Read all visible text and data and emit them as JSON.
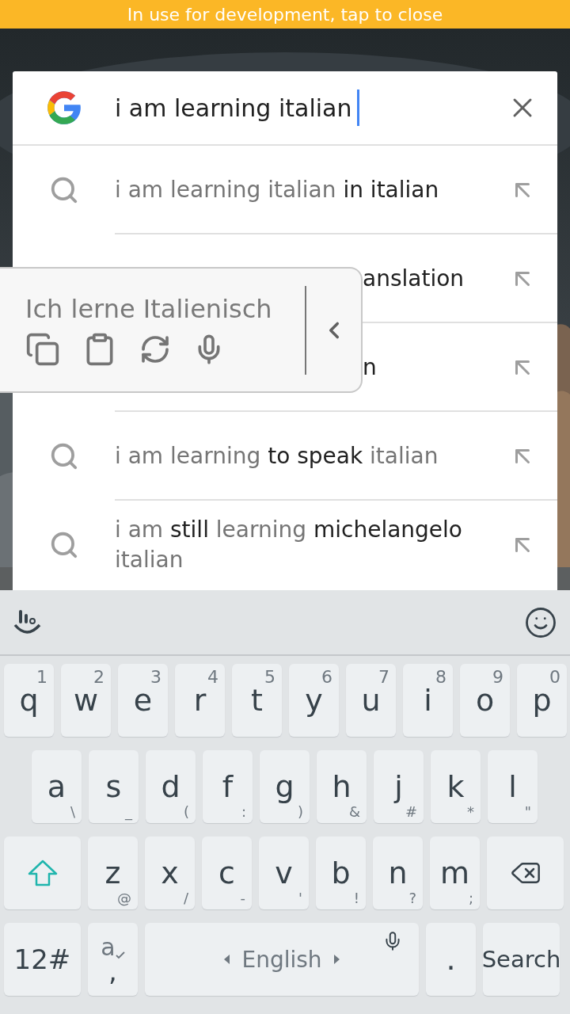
{
  "status_banner": {
    "text": "In use for development, tap to close"
  },
  "search": {
    "query": "i am learning italian",
    "focused": true
  },
  "suggestions": [
    {
      "covered": false,
      "segments": [
        {
          "text": "i am learning italian ",
          "typed": true
        },
        {
          "text": "in italian",
          "typed": false
        }
      ]
    },
    {
      "covered": true,
      "segments": [
        {
          "text": "anslation",
          "typed": false
        }
      ]
    },
    {
      "covered": true,
      "segments": [
        {
          "text": "n",
          "typed": false
        }
      ]
    },
    {
      "covered": false,
      "segments": [
        {
          "text": "i am learning ",
          "typed": true
        },
        {
          "text": "to speak",
          "typed": false
        },
        {
          "text": " italian",
          "typed": true
        }
      ]
    },
    {
      "covered": false,
      "segments": [
        {
          "text": "i am ",
          "typed": true
        },
        {
          "text": "still",
          "typed": false
        },
        {
          "text": " learning ",
          "typed": true
        },
        {
          "text": "michelangelo",
          "typed": false
        },
        {
          "text": " italian",
          "typed": true
        }
      ]
    }
  ],
  "translation_popup": {
    "text": "Ich lerne Italienisch"
  },
  "keyboard": {
    "rows": [
      {
        "keys": [
          {
            "kind": "letter",
            "char": "q",
            "number": "1"
          },
          {
            "kind": "letter",
            "char": "w",
            "number": "2"
          },
          {
            "kind": "letter",
            "char": "e",
            "number": "3"
          },
          {
            "kind": "letter",
            "char": "r",
            "number": "4"
          },
          {
            "kind": "letter",
            "char": "t",
            "number": "5"
          },
          {
            "kind": "letter",
            "char": "y",
            "number": "6"
          },
          {
            "kind": "letter",
            "char": "u",
            "number": "7"
          },
          {
            "kind": "letter",
            "char": "i",
            "number": "8"
          },
          {
            "kind": "letter",
            "char": "o",
            "number": "9"
          },
          {
            "kind": "letter",
            "char": "p",
            "number": "0"
          }
        ]
      },
      {
        "keys": [
          {
            "kind": "letter",
            "char": "a",
            "symbol": "\\"
          },
          {
            "kind": "letter",
            "char": "s",
            "symbol": "_"
          },
          {
            "kind": "letter",
            "char": "d",
            "symbol": "("
          },
          {
            "kind": "letter",
            "char": "f",
            "symbol": ":"
          },
          {
            "kind": "letter",
            "char": "g",
            "symbol": ")"
          },
          {
            "kind": "letter",
            "char": "h",
            "symbol": "&"
          },
          {
            "kind": "letter",
            "char": "j",
            "symbol": "#"
          },
          {
            "kind": "letter",
            "char": "k",
            "symbol": "*"
          },
          {
            "kind": "letter",
            "char": "l",
            "symbol": "\""
          }
        ]
      },
      {
        "keys": [
          {
            "kind": "shift"
          },
          {
            "kind": "letter",
            "char": "z",
            "symbol": "@"
          },
          {
            "kind": "letter",
            "char": "x",
            "symbol": "/"
          },
          {
            "kind": "letter",
            "char": "c",
            "symbol": "-"
          },
          {
            "kind": "letter",
            "char": "v",
            "symbol": "'"
          },
          {
            "kind": "letter",
            "char": "b",
            "symbol": "!"
          },
          {
            "kind": "letter",
            "char": "n",
            "symbol": "?"
          },
          {
            "kind": "letter",
            "char": "m",
            "symbol": ";"
          },
          {
            "kind": "backspace"
          }
        ]
      },
      {
        "keys": [
          {
            "kind": "mode",
            "label": "12#"
          },
          {
            "kind": "accent",
            "char": "a",
            "symbol": ","
          },
          {
            "kind": "space",
            "label": "English"
          },
          {
            "kind": "period",
            "char": "."
          },
          {
            "kind": "action",
            "label": "Search"
          }
        ]
      }
    ]
  }
}
